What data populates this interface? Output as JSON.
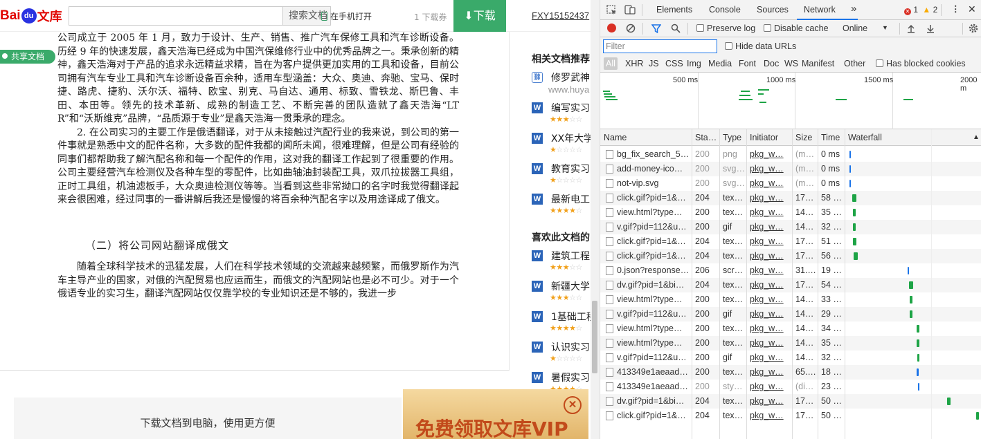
{
  "site": {
    "logo_a": "Bai",
    "logo_b": "du",
    "logo_c": "文库",
    "search_btn": "搜索文档",
    "phone_open": "在手机打开",
    "download_count": "1 下载券",
    "download_btn": "⬇下载",
    "user": "FXY15152437"
  },
  "share_tag": "共享文档",
  "doc": {
    "p1": "公司成立于 2005 年 1 月，致力于设计、生产、销售、推广汽车保修工具和汽车诊断设备。历经 9 年的快速发展，鑫天浩海已经成为中国汽保维修行业中的优秀品牌之一。秉承创新的精神，鑫天浩海对于产品的追求永远精益求精，旨在为客户提供更加实用的工具和设备，目前公司拥有汽车专业工具和汽车诊断设备百余种，适用车型涵盖：大众、奥迪、奔驰、宝马、保时捷、路虎、捷豹、沃尔沃、福特、欧宝、别克、马自达、通用、标致、雪铁龙、斯巴鲁、丰田、本田等。领先的技术革新、成熟的制造工艺、不断完善的团队造就了鑫天浩海“LTR”和“沃斯维克”品牌，“品质源于专业”是鑫天浩海一贯秉承的理念。",
    "p2": "2. 在公司实习的主要工作是俄语翻译，对于从未接触过汽配行业的我来说，到公司的第一件事就是熟悉中文的配件名称，大多数的配件我都的闻所未闻，很难理解，但是公司有经验的同事们都帮助我了解汽配名称和每一个配件的作用，这对我的翻译工作起到了很重要的作用。公司主要经营汽车检测仪及各种车型的零配件，比如曲轴油封装配工具，双爪拉拔器工具组，正时工具组，机油滤板手，大众奥迪检测仪等等。当看到这些非常拗口的名字时我觉得翻译起来会很困难，经过同事的一番讲解后我还是慢慢的将百余种汽配名字以及用途译成了俄文。",
    "h2": "（二）将公司网站翻译成俄文",
    "p3": "随着全球科学技术的迅猛发展，人们在科学技术领域的交流越来越频繁，而俄罗斯作为汽车主导产业的国家，对俄的汽配贸易也应运而生，而俄文的汽配网站也是必不可少。对于一个俄语专业的实习生，翻译汽配网站仅仅靠学校的专业知识还是不够的，我进一步"
  },
  "sidebar": {
    "hdr1": "相关文档推荐",
    "hdr2": "喜欢此文档的",
    "items": [
      {
        "icon": "link",
        "title": "修罗武神",
        "sub": "www.huya",
        "stars": 0
      },
      {
        "icon": "W",
        "title": "编写实习",
        "stars": 3
      },
      {
        "icon": "W",
        "title": "XX年大学",
        "stars": 1
      },
      {
        "icon": "W",
        "title": "教育实习",
        "stars": 1
      },
      {
        "icon": "W",
        "title": "最新电工",
        "stars": 4
      },
      {
        "icon": "W",
        "title": "建筑工程",
        "stars": 3
      },
      {
        "icon": "W",
        "title": "新疆大学",
        "stars": 3
      },
      {
        "icon": "W",
        "title": "1基础工程",
        "stars": 4
      },
      {
        "icon": "W",
        "title": "认识实习",
        "stars": 1
      },
      {
        "icon": "W",
        "title": "暑假实习",
        "stars": 4
      }
    ]
  },
  "bottom": {
    "download_pc": "下载文档到电脑，使用更方便",
    "vip": "免费领取文库VIP",
    "vip_close": "✕"
  },
  "devtools": {
    "tabs": [
      "Elements",
      "Console",
      "Sources",
      "Network"
    ],
    "more": "»",
    "errors": "1",
    "warnings": "2",
    "toolbar": {
      "preserve_log": "Preserve log",
      "disable_cache": "Disable cache",
      "throttle": "Online"
    },
    "filter_placeholder": "Filter",
    "hide_data_urls": "Hide data URLs",
    "types": [
      "All",
      "XHR",
      "JS",
      "CSS",
      "Img",
      "Media",
      "Font",
      "Doc",
      "WS",
      "Manifest",
      "Other"
    ],
    "blocked": "Has blocked cookies",
    "timeline_labels": [
      "500 ms",
      "1000 ms",
      "1500 ms",
      "2000 m"
    ],
    "columns": [
      "Name",
      "Sta…",
      "Type",
      "Initiator",
      "Size",
      "Time",
      "Waterfall"
    ],
    "rows": [
      {
        "name": "bg_fix_search_5…",
        "status": "200",
        "type": "png",
        "init": "pkg_w…",
        "size": "(m…",
        "time": "0 ms",
        "wf": 0.4,
        "ww": 0.2,
        "dim": true
      },
      {
        "name": "add-money-ico…",
        "status": "200",
        "type": "svg…",
        "init": "pkg_w…",
        "size": "(m…",
        "time": "0 ms",
        "wf": 0.4,
        "ww": 0.2,
        "dim": true
      },
      {
        "name": "not-vip.svg",
        "status": "200",
        "type": "svg…",
        "init": "pkg_w…",
        "size": "(m…",
        "time": "0 ms",
        "wf": 0.4,
        "ww": 0.2,
        "dim": true
      },
      {
        "name": "click.gif?pid=1&…",
        "status": "204",
        "type": "tex…",
        "init": "pkg_w…",
        "size": "17…",
        "time": "58 …",
        "wf": 1.0,
        "ww": 1.0
      },
      {
        "name": "view.html?type…",
        "status": "200",
        "type": "tex…",
        "init": "pkg_w…",
        "size": "14…",
        "time": "35 …",
        "wf": 1.2,
        "ww": 0.6
      },
      {
        "name": "v.gif?pid=112&u…",
        "status": "200",
        "type": "gif",
        "init": "pkg_w…",
        "size": "14…",
        "time": "32 …",
        "wf": 1.2,
        "ww": 0.6
      },
      {
        "name": "click.gif?pid=1&…",
        "status": "204",
        "type": "tex…",
        "init": "pkg_w…",
        "size": "17…",
        "time": "51 …",
        "wf": 1.2,
        "ww": 0.9
      },
      {
        "name": "click.gif?pid=1&…",
        "status": "204",
        "type": "tex…",
        "init": "pkg_w…",
        "size": "17…",
        "time": "56 …",
        "wf": 1.4,
        "ww": 1.0
      },
      {
        "name": "0.json?response…",
        "status": "206",
        "type": "scr…",
        "init": "pkg_w…",
        "size": "31.…",
        "time": "19 …",
        "wf": 14.5,
        "ww": 0.4
      },
      {
        "name": "dv.gif?pid=1&bi…",
        "status": "204",
        "type": "tex…",
        "init": "pkg_w…",
        "size": "17…",
        "time": "54 …",
        "wf": 14.9,
        "ww": 1.0
      },
      {
        "name": "view.html?type…",
        "status": "200",
        "type": "tex…",
        "init": "pkg_w…",
        "size": "14…",
        "time": "33 …",
        "wf": 15.1,
        "ww": 0.6
      },
      {
        "name": "v.gif?pid=112&u…",
        "status": "200",
        "type": "gif",
        "init": "pkg_w…",
        "size": "14…",
        "time": "29 …",
        "wf": 15.1,
        "ww": 0.6
      },
      {
        "name": "view.html?type…",
        "status": "200",
        "type": "tex…",
        "init": "pkg_w…",
        "size": "14…",
        "time": "34 …",
        "wf": 16.8,
        "ww": 0.6
      },
      {
        "name": "view.html?type…",
        "status": "200",
        "type": "tex…",
        "init": "pkg_w…",
        "size": "14…",
        "time": "35 …",
        "wf": 16.8,
        "ww": 0.6
      },
      {
        "name": "v.gif?pid=112&u…",
        "status": "200",
        "type": "gif",
        "init": "pkg_w…",
        "size": "14…",
        "time": "32 …",
        "wf": 16.9,
        "ww": 0.6
      },
      {
        "name": "413349e1aeaad…",
        "status": "200",
        "type": "tex…",
        "init": "pkg_w…",
        "size": "65.…",
        "time": "18 …",
        "wf": 16.8,
        "ww": 0.4
      },
      {
        "name": "413349e1aeaad…",
        "status": "200",
        "type": "sty…",
        "init": "pkg_w…",
        "size": "(di…",
        "time": "23 …",
        "wf": 17.1,
        "ww": 0.4,
        "dim": true
      },
      {
        "name": "dv.gif?pid=1&bi…",
        "status": "204",
        "type": "tex…",
        "init": "pkg_w…",
        "size": "17…",
        "time": "50 …",
        "wf": 24.3,
        "ww": 0.8
      },
      {
        "name": "click.gif?pid=1&…",
        "status": "204",
        "type": "tex…",
        "init": "pkg_w…",
        "size": "17…",
        "time": "50 …",
        "wf": 31.3,
        "ww": 0.8
      }
    ],
    "colors": {
      "accent": "#1a73e8",
      "green": "#1ea446",
      "record": "#d93025"
    }
  }
}
